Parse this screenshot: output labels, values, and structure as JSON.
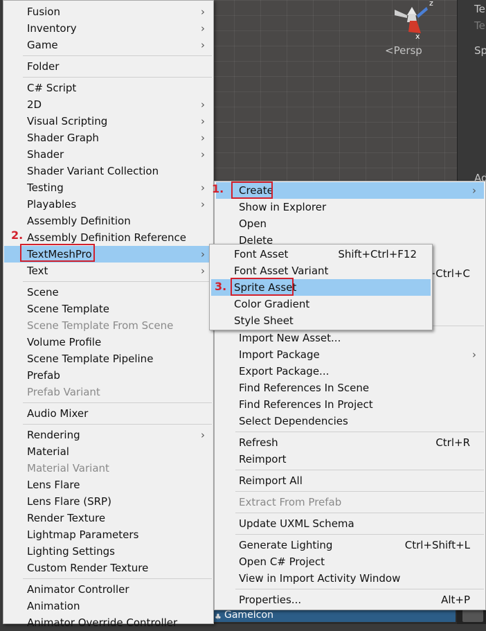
{
  "scene": {
    "gizmo_axis_z": "z",
    "gizmo_axis_x": "x",
    "persp_label": "Persp"
  },
  "inspector": {
    "line1": "Te",
    "line2": "Te",
    "line3": "Sp",
    "line4": "Ad"
  },
  "project": {
    "selected_item": "GameIcon"
  },
  "left_menu": {
    "items": [
      {
        "label": "Fusion",
        "submenu": true
      },
      {
        "label": "Inventory",
        "submenu": true
      },
      {
        "label": "Game",
        "submenu": true
      },
      {
        "label": "Folder",
        "submenu": false
      },
      {
        "label": "C# Script",
        "submenu": false
      },
      {
        "label": "2D",
        "submenu": true
      },
      {
        "label": "Visual Scripting",
        "submenu": true
      },
      {
        "label": "Shader Graph",
        "submenu": true
      },
      {
        "label": "Shader",
        "submenu": true
      },
      {
        "label": "Shader Variant Collection",
        "submenu": false
      },
      {
        "label": "Testing",
        "submenu": true
      },
      {
        "label": "Playables",
        "submenu": true
      },
      {
        "label": "Assembly Definition",
        "submenu": false
      },
      {
        "label": "Assembly Definition Reference",
        "submenu": false
      },
      {
        "label": "TextMeshPro",
        "submenu": true
      },
      {
        "label": "Text",
        "submenu": true
      },
      {
        "label": "Scene",
        "submenu": false
      },
      {
        "label": "Scene Template",
        "submenu": false
      },
      {
        "label": "Scene Template From Scene",
        "submenu": false
      },
      {
        "label": "Volume Profile",
        "submenu": false
      },
      {
        "label": "Scene Template Pipeline",
        "submenu": false
      },
      {
        "label": "Prefab",
        "submenu": false
      },
      {
        "label": "Prefab Variant",
        "submenu": false
      },
      {
        "label": "Audio Mixer",
        "submenu": false
      },
      {
        "label": "Rendering",
        "submenu": true
      },
      {
        "label": "Material",
        "submenu": false
      },
      {
        "label": "Material Variant",
        "submenu": false
      },
      {
        "label": "Lens Flare",
        "submenu": false
      },
      {
        "label": "Lens Flare (SRP)",
        "submenu": false
      },
      {
        "label": "Render Texture",
        "submenu": false
      },
      {
        "label": "Lightmap Parameters",
        "submenu": false
      },
      {
        "label": "Lighting Settings",
        "submenu": false
      },
      {
        "label": "Custom Render Texture",
        "submenu": false
      },
      {
        "label": "Animator Controller",
        "submenu": false
      },
      {
        "label": "Animation",
        "submenu": false
      },
      {
        "label": "Animator Override Controller",
        "submenu": false
      }
    ],
    "arrow_glyph": "›"
  },
  "context_menu": {
    "items": [
      {
        "label": "Create",
        "shortcut": "",
        "submenu": true
      },
      {
        "label": "Show in Explorer",
        "shortcut": ""
      },
      {
        "label": "Open",
        "shortcut": ""
      },
      {
        "label": "Delete",
        "shortcut": ""
      },
      {
        "label": "",
        "shortcut": "+Ctrl+C"
      },
      {
        "label": "Import New Asset...",
        "shortcut": ""
      },
      {
        "label": "Import Package",
        "shortcut": "",
        "submenu": true
      },
      {
        "label": "Export Package...",
        "shortcut": ""
      },
      {
        "label": "Find References In Scene",
        "shortcut": ""
      },
      {
        "label": "Find References In Project",
        "shortcut": ""
      },
      {
        "label": "Select Dependencies",
        "shortcut": ""
      },
      {
        "label": "Refresh",
        "shortcut": "Ctrl+R"
      },
      {
        "label": "Reimport",
        "shortcut": ""
      },
      {
        "label": "Reimport All",
        "shortcut": ""
      },
      {
        "label": "Extract From Prefab",
        "shortcut": ""
      },
      {
        "label": "Update UXML Schema",
        "shortcut": ""
      },
      {
        "label": "Generate Lighting",
        "shortcut": "Ctrl+Shift+L"
      },
      {
        "label": "Open C# Project",
        "shortcut": ""
      },
      {
        "label": "View in Import Activity Window",
        "shortcut": ""
      },
      {
        "label": "Properties...",
        "shortcut": "Alt+P"
      }
    ]
  },
  "tmp_menu": {
    "items": [
      {
        "label": "Font Asset",
        "shortcut": "Shift+Ctrl+F12"
      },
      {
        "label": "Font Asset Variant",
        "shortcut": ""
      },
      {
        "label": "Sprite Asset",
        "shortcut": ""
      },
      {
        "label": "Color Gradient",
        "shortcut": ""
      },
      {
        "label": "Style Sheet",
        "shortcut": ""
      }
    ]
  },
  "annotations": {
    "step1": "1.",
    "step2": "2.",
    "step3": "3."
  }
}
